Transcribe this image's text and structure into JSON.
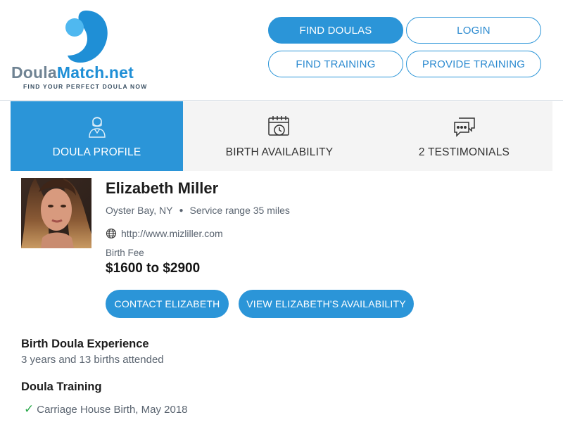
{
  "header": {
    "logo": {
      "word_a": "Doula",
      "word_b": "Match.net",
      "tagline": "FIND YOUR PERFECT DOULA NOW",
      "colors": {
        "gray": "#6f8393",
        "blue": "#1f8fd6",
        "light_blue": "#4fb8f0"
      }
    },
    "nav": {
      "find_doulas": "FIND DOULAS",
      "login": "LOGIN",
      "find_training": "FIND TRAINING",
      "provide_training": "PROVIDE TRAINING"
    }
  },
  "tabs": [
    {
      "label": "DOULA PROFILE",
      "icon": "person-icon",
      "active": true
    },
    {
      "label": "BIRTH AVAILABILITY",
      "icon": "calendar-clock-icon",
      "active": false
    },
    {
      "label": "2 TESTIMONIALS",
      "icon": "chat-bubbles-icon",
      "active": false
    }
  ],
  "profile": {
    "name": "Elizabeth Miller",
    "location": "Oyster Bay, NY",
    "service_range": "Service range 35 miles",
    "website": "http://www.mizliller.com",
    "fee_label": "Birth Fee",
    "fee": "$1600 to $2900",
    "contact_button": "CONTACT ELIZABETH",
    "availability_button": "VIEW ELIZABETH'S AVAILABILITY"
  },
  "experience": {
    "title": "Birth Doula Experience",
    "text": "3 years and 13 births attended"
  },
  "training": {
    "title": "Doula Training",
    "items": [
      "Carriage House Birth, May 2018"
    ]
  },
  "colors": {
    "accent": "#2b95d8",
    "tab_bg": "#f4f4f4",
    "check": "#2aa84a"
  }
}
